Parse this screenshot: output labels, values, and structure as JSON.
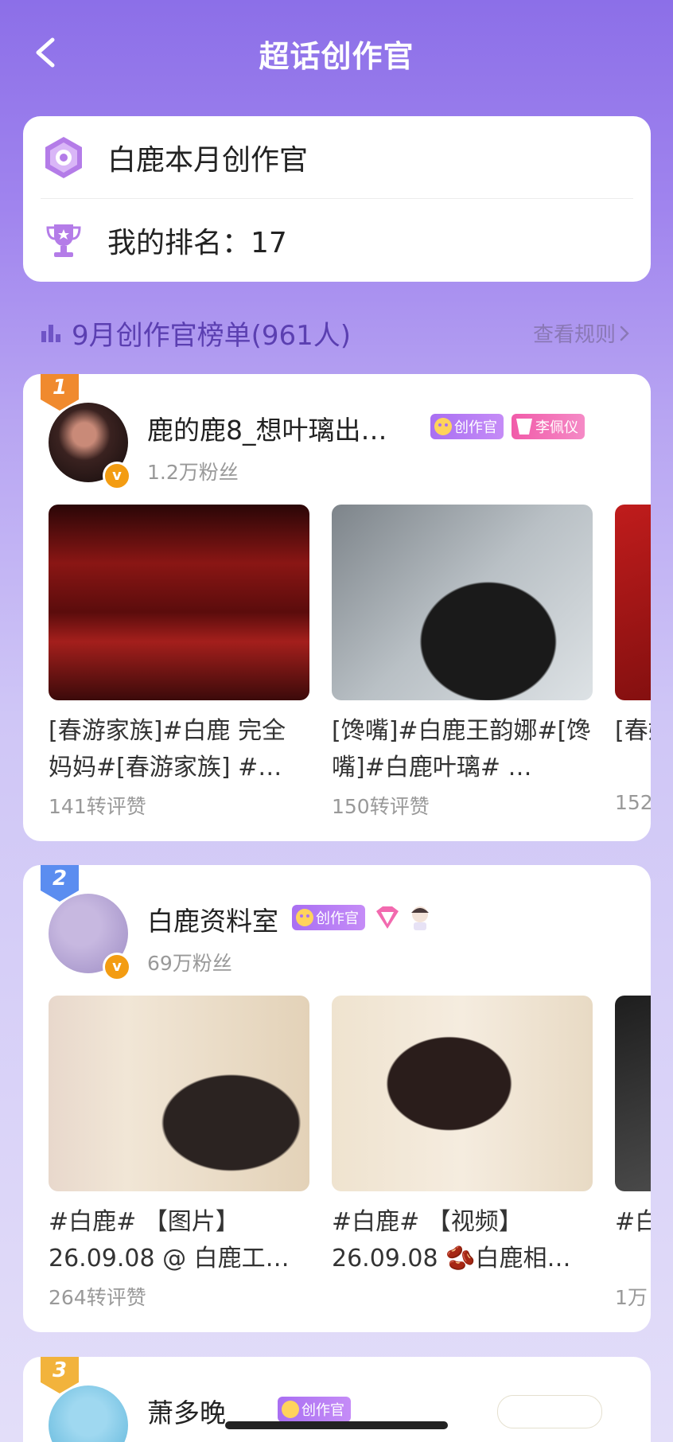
{
  "nav": {
    "title": "超话创作官"
  },
  "info": {
    "month_title": "白鹿本月创作官",
    "my_rank_label": "我的排名：17"
  },
  "section": {
    "title": "9月创作官榜单(961人)",
    "rules_label": "查看规则"
  },
  "colors": {
    "accent": "#5b3fb1",
    "tag_purple": "#b77cf5",
    "tag_pink": "#f26aaf",
    "rank1": "#f08a2e",
    "rank2": "#5b8df0",
    "rank3": "#f2b33c"
  },
  "ranks": [
    {
      "rank": "1",
      "name": "鹿的鹿8_想叶璃出…",
      "fans": "1.2万粉丝",
      "tags": [
        "创作官",
        "李佩仪"
      ],
      "tag_icons": [
        "creator-icon",
        "rank-17-badge-icon"
      ],
      "posts": [
        {
          "text": "[春游家族]#白鹿 完全妈妈#[春游家族] #…",
          "meta": "141转评赞"
        },
        {
          "text": "[馋嘴]#白鹿王韵娜#[馋嘴]#白鹿叶璃# …",
          "meta": "150转评赞"
        },
        {
          "text": "[春娜#",
          "meta": "152"
        }
      ]
    },
    {
      "rank": "2",
      "name": "白鹿资料室",
      "fans": "69万粉丝",
      "tags": [
        "创作官"
      ],
      "tag_icons": [
        "creator-icon",
        "diamond-badge-icon",
        "character-badge-icon"
      ],
      "posts": [
        {
          "text": "#白鹿# 【图片】26.09.08 @ 白鹿工…",
          "meta": "264转评赞"
        },
        {
          "text": "#白鹿# 【视频】26.09.08 🫘白鹿相…",
          "meta": ""
        },
        {
          "text": "#白王冒",
          "meta": "1万"
        }
      ]
    },
    {
      "rank": "3",
      "name": "萧多晚",
      "tags": [
        "创作官"
      ]
    }
  ]
}
